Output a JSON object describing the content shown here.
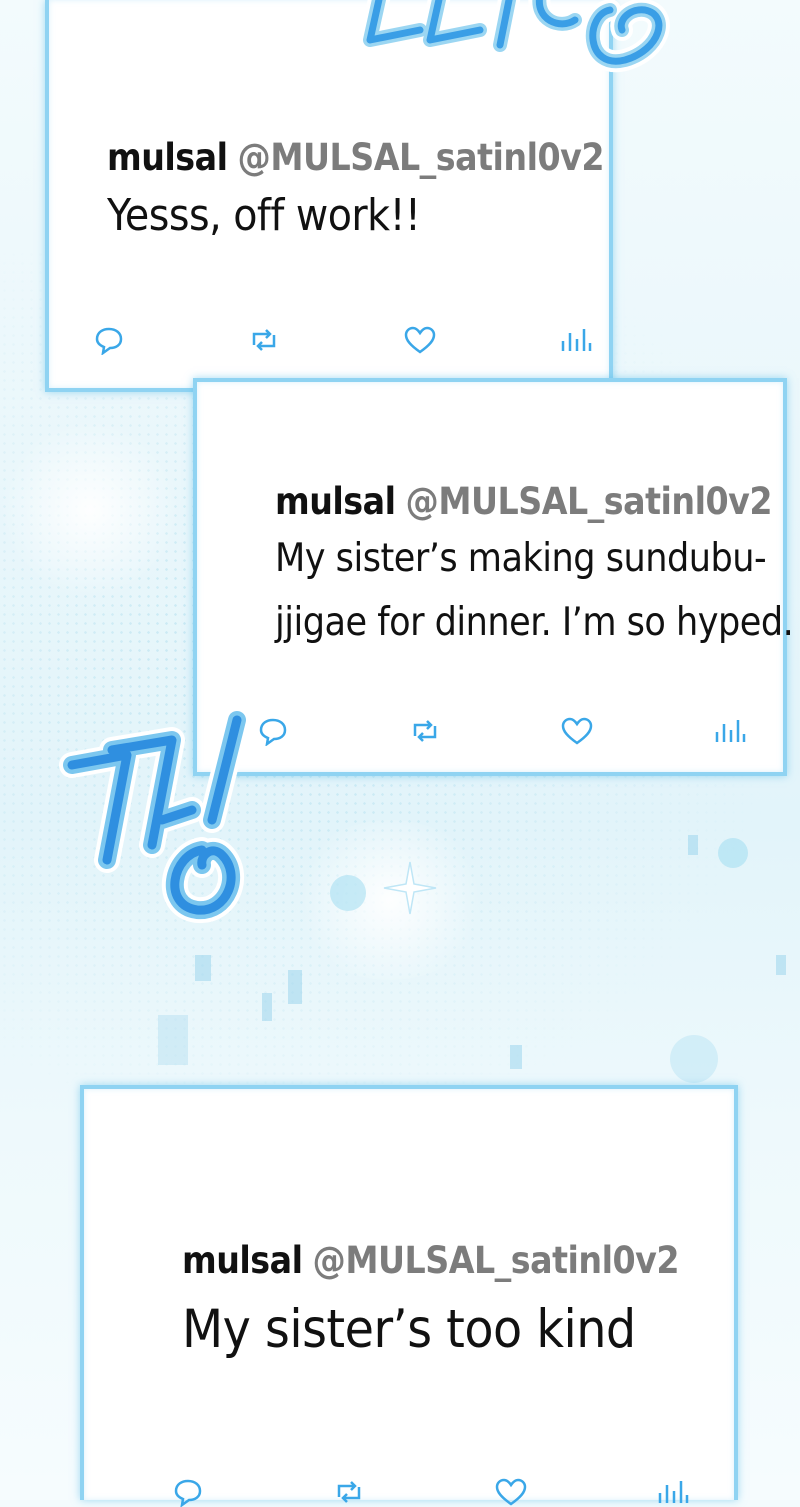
{
  "tweets": [
    {
      "name": "mulsal",
      "handle": "@MULSAL_satinl0v2",
      "text": "Yesss, off work!!"
    },
    {
      "name": "mulsal",
      "handle": "@MULSAL_satinl0v2",
      "text_line1": "My sister’s making sundubu-",
      "text_line2": "jjigae for dinner. I’m so hyped."
    },
    {
      "name": "mulsal",
      "handle": "@MULSAL_satinl0v2",
      "text": "My sister’s too kind"
    }
  ],
  "icons": [
    "reply-icon",
    "retweet-icon",
    "like-icon",
    "views-icon"
  ],
  "colors": {
    "accent": "#3aa7e8",
    "frame": "#8fd3f2",
    "handle_gray": "#7c7c7c"
  }
}
